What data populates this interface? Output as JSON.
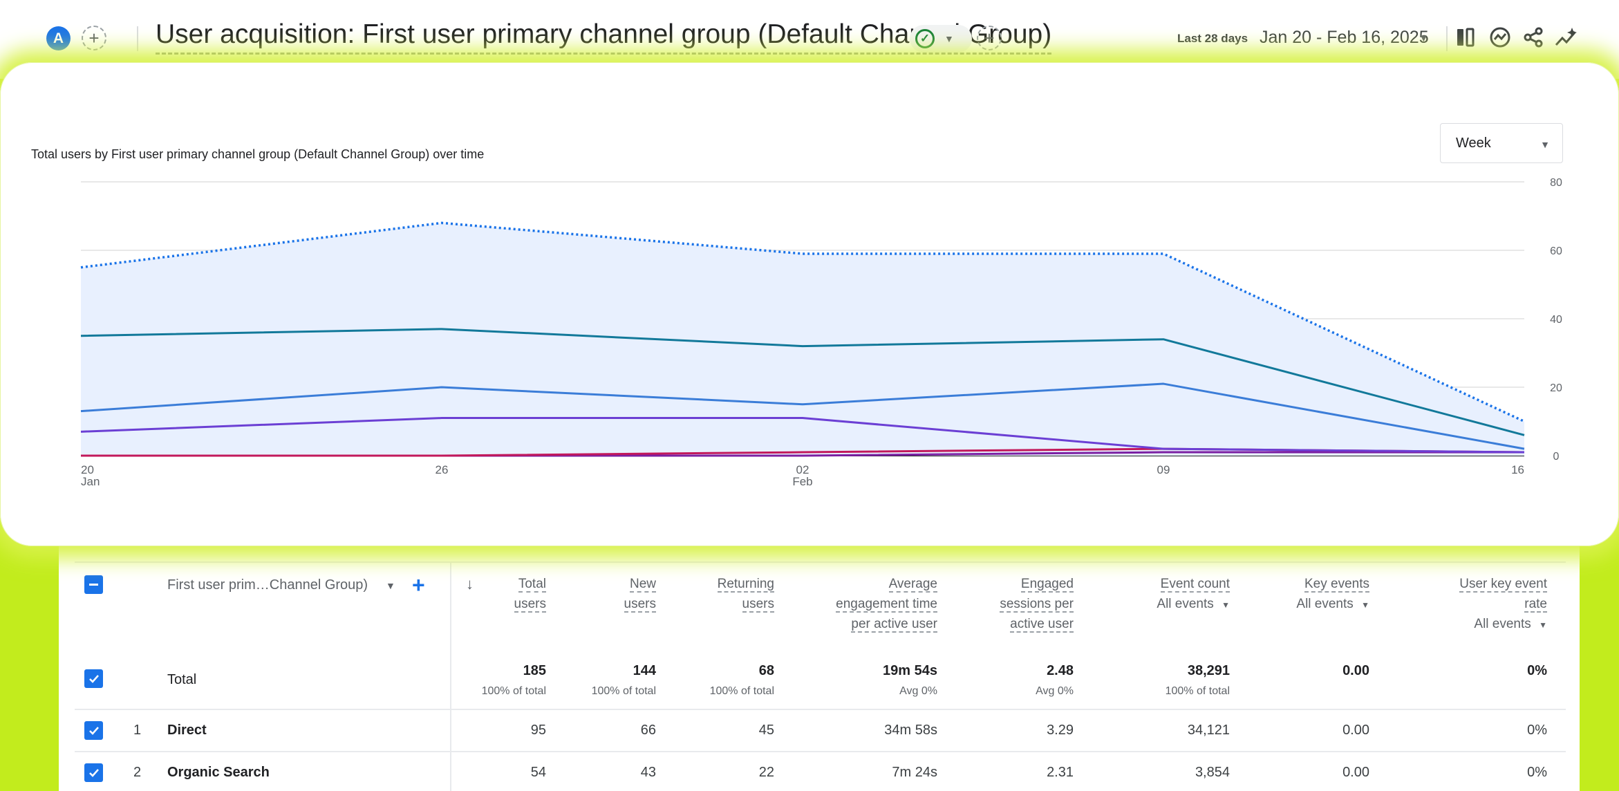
{
  "header": {
    "avatar_letter": "A",
    "title": "User acquisition: First user primary channel group (Default Channel Group)",
    "date_prefix": "Last 28 days",
    "date_range": "Jan 20 - Feb 16, 2025"
  },
  "chart": {
    "title": "Total users by First user primary channel group (Default Channel Group) over time",
    "granularity": "Week",
    "y_ticks": [
      "80",
      "60",
      "40",
      "20",
      "0"
    ],
    "x_ticks": [
      {
        "day": "20",
        "month": "Jan"
      },
      {
        "day": "26",
        "month": ""
      },
      {
        "day": "02",
        "month": "Feb"
      },
      {
        "day": "09",
        "month": ""
      },
      {
        "day": "16",
        "month": ""
      }
    ]
  },
  "chart_data": {
    "type": "line",
    "x": [
      "Jan 20",
      "Jan 26",
      "Feb 02",
      "Feb 09",
      "Feb 16"
    ],
    "ylim": [
      0,
      80
    ],
    "grid": true,
    "series": [
      {
        "values": [
          55,
          68,
          59,
          59,
          10
        ],
        "color": "#1a73e8",
        "style": "dotted",
        "fill": "#e8f0fe"
      },
      {
        "values": [
          35,
          37,
          32,
          34,
          6
        ],
        "color": "#12799a",
        "style": "solid"
      },
      {
        "values": [
          13,
          20,
          15,
          21,
          2
        ],
        "color": "#3b7dd8",
        "style": "solid"
      },
      {
        "values": [
          7,
          11,
          11,
          2,
          1
        ],
        "color": "#6b3fd4",
        "style": "solid"
      },
      {
        "values": [
          0,
          0,
          1,
          2,
          1
        ],
        "color": "#c2185b",
        "style": "solid"
      },
      {
        "values": [
          0,
          0,
          0,
          1,
          1
        ],
        "color": "#7b1fa2",
        "style": "solid"
      }
    ]
  },
  "table": {
    "dimension_header": "First user prim…Channel Group)",
    "columns": [
      {
        "lines": [
          "Total",
          "users"
        ],
        "dropdown": false
      },
      {
        "lines": [
          "New",
          "users"
        ],
        "dropdown": false
      },
      {
        "lines": [
          "Returning",
          "users"
        ],
        "dropdown": false
      },
      {
        "lines": [
          "Average",
          "engagement time",
          "per active user"
        ],
        "dropdown": false
      },
      {
        "lines": [
          "Engaged",
          "sessions per",
          "active user"
        ],
        "dropdown": false
      },
      {
        "lines": [
          "Event count"
        ],
        "sub": "All events",
        "dropdown": true
      },
      {
        "lines": [
          "Key events"
        ],
        "sub": "All events",
        "dropdown": true
      },
      {
        "lines": [
          "User key event",
          "rate"
        ],
        "sub": "All events",
        "dropdown": true
      }
    ],
    "total": {
      "label": "Total",
      "values": [
        "185",
        "144",
        "68",
        "19m 54s",
        "2.48",
        "38,291",
        "0.00",
        "0%"
      ],
      "subs": [
        "100% of total",
        "100% of total",
        "100% of total",
        "Avg 0%",
        "Avg 0%",
        "100% of total",
        "",
        ""
      ]
    },
    "rows": [
      {
        "rank": "1",
        "label": "Direct",
        "values": [
          "95",
          "66",
          "45",
          "34m 58s",
          "3.29",
          "34,121",
          "0.00",
          "0%"
        ]
      },
      {
        "rank": "2",
        "label": "Organic Search",
        "values": [
          "54",
          "43",
          "22",
          "7m 24s",
          "2.31",
          "3,854",
          "0.00",
          "0%"
        ]
      }
    ]
  }
}
